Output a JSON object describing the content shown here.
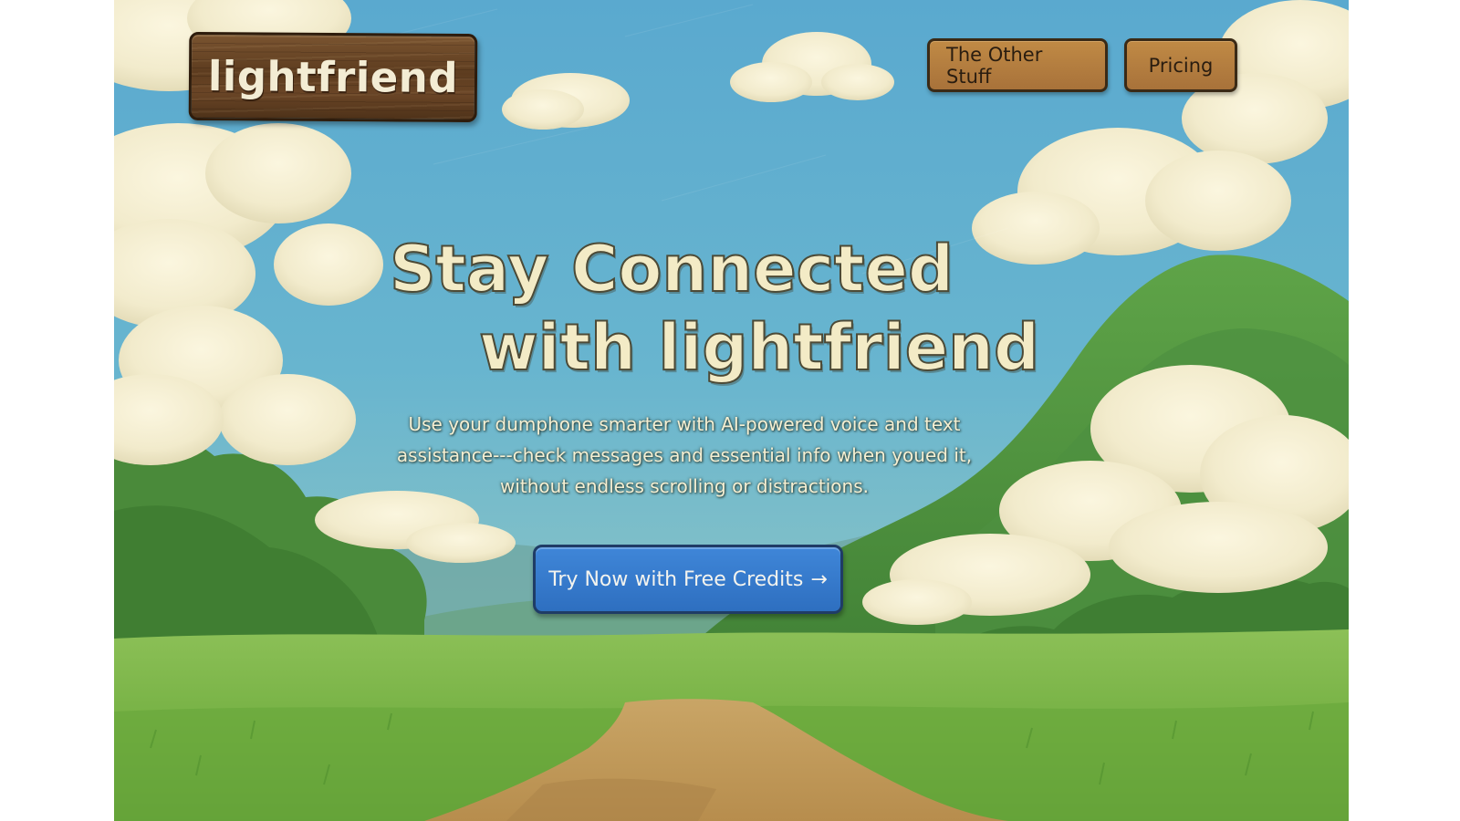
{
  "brand": {
    "name": "lightfriend"
  },
  "nav": {
    "items": [
      {
        "label": "The Other Stuff"
      },
      {
        "label": "Pricing"
      }
    ]
  },
  "hero": {
    "title_line1": "Stay Connected",
    "title_line2": "with lightfriend",
    "subtitle": "Use your dumphone smarter with AI-powered voice and text assistance---check messages and essential info when youed it, without endless scrolling or distractions.",
    "cta_label": "Try Now with Free Credits",
    "cta_arrow": "→"
  },
  "icons": {
    "cta_arrow": "arrow-right-icon"
  },
  "colors": {
    "sky": "#5eaed0",
    "grass": "#7ab548",
    "path": "#c49a5a",
    "wood_sign": "#5d3c1f",
    "nav_button": "#b17c3f",
    "cta": "#3479cc",
    "headline_text": "#f3ebc6"
  }
}
